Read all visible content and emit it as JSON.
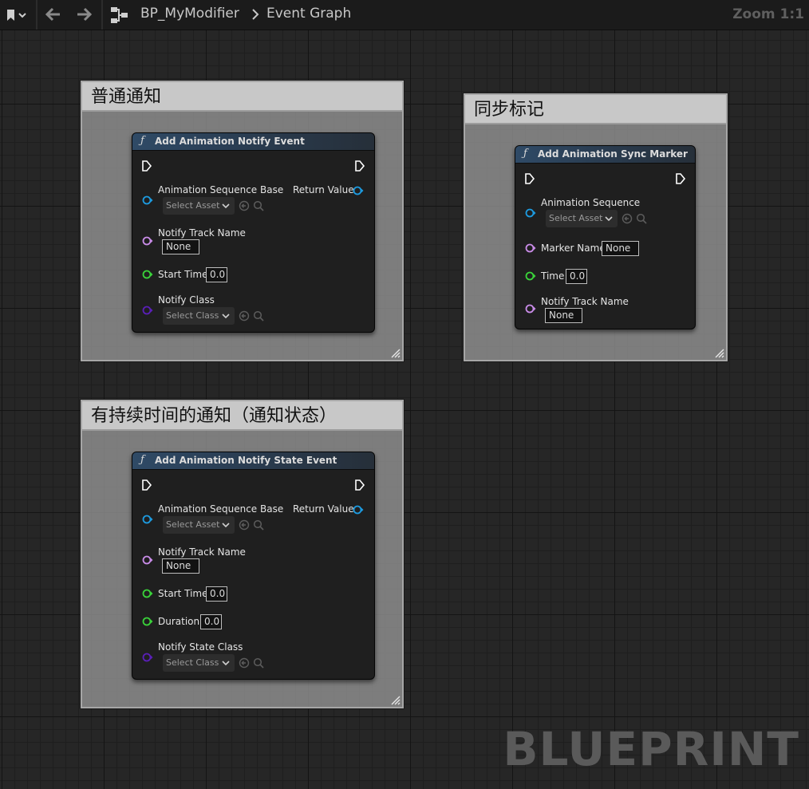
{
  "toolbar": {
    "breadcrumb_asset": "BP_MyModifier",
    "breadcrumb_graph": "Event Graph",
    "zoom": "Zoom 1:1"
  },
  "comments": {
    "normal": "普通通知",
    "sync": "同步标记",
    "state": "有持续时间的通知（通知状态）"
  },
  "node_notify": {
    "title": "Add Animation Notify Event",
    "pin_sequence": "Animation Sequence Base",
    "sequence_select": "Select Asset",
    "return_value": "Return Value",
    "pin_track": "Notify Track Name",
    "track_value": "None",
    "pin_start": "Start Time",
    "start_value": "0.0",
    "pin_class": "Notify Class",
    "class_select": "Select Class"
  },
  "node_sync": {
    "title": "Add Animation Sync Marker",
    "pin_sequence": "Animation Sequence",
    "sequence_select": "Select Asset",
    "pin_marker": "Marker Name",
    "marker_value": "None",
    "pin_time": "Time",
    "time_value": "0.0",
    "pin_track": "Notify Track Name",
    "track_value": "None"
  },
  "node_state": {
    "title": "Add Animation Notify State Event",
    "pin_sequence": "Animation Sequence Base",
    "sequence_select": "Select Asset",
    "return_value": "Return Value",
    "pin_track": "Notify Track Name",
    "track_value": "None",
    "pin_start": "Start Time",
    "start_value": "0.0",
    "pin_duration": "Duration",
    "duration_value": "0.0",
    "pin_class": "Notify State Class",
    "class_select": "Select Class"
  },
  "watermark": "BLUEPRINT",
  "colors": {
    "object_pin": "#1d9be0",
    "name_pin": "#c98ce8",
    "float_pin": "#3ad33a",
    "class_pin": "#5a1fb8",
    "exec_pin": "#ffffff"
  }
}
